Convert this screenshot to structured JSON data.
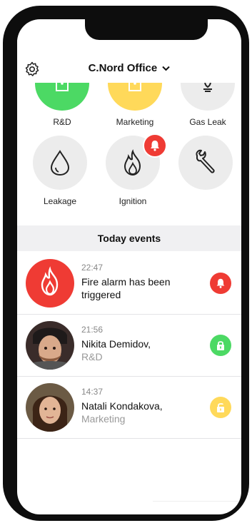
{
  "header": {
    "title": "C.Nord Office"
  },
  "colors": {
    "green": "#4cd964",
    "yellow": "#ffd95a",
    "gray": "#ececec",
    "red": "#ef3b34"
  },
  "tiles": [
    {
      "label": "R&D",
      "icon": "door-icon"
    },
    {
      "label": "Marketing",
      "icon": "door-icon"
    },
    {
      "label": "Gas Leak",
      "icon": "flame-sensor-icon"
    },
    {
      "label": "Leakage",
      "icon": "water-drop-icon"
    },
    {
      "label": "Ignition",
      "icon": "fire-icon"
    },
    {
      "label": "",
      "icon": "wrench-icon"
    }
  ],
  "events_header": "Today events",
  "events": [
    {
      "time": "22:47",
      "line1": "Fire alarm has been",
      "line2": "triggered",
      "status": "alarm-bell-icon"
    },
    {
      "time": "21:56",
      "line1": "Nikita Demidov,",
      "line2": "R&D",
      "status": "lock-closed-icon"
    },
    {
      "time": "14:37",
      "line1": "Natali Kondakova,",
      "line2": "Marketing",
      "status": "lock-open-icon"
    }
  ]
}
